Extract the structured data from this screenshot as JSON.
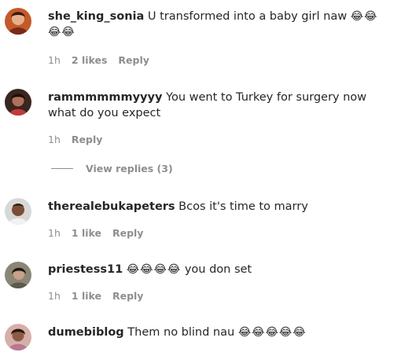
{
  "comments": [
    {
      "username": "she_king_sonia",
      "text": " U transformed into a baby girl naw ",
      "emoji": "😂😂😂😂",
      "time": "1h",
      "likes": "2 likes",
      "reply": "Reply"
    },
    {
      "username": "rammmmmmyyyy",
      "text": " You went to Turkey for surgery now what do you expect",
      "emoji": "",
      "time": "1h",
      "likes": "",
      "reply": "Reply",
      "view_replies": "View replies (3)"
    },
    {
      "username": "therealebukapeters",
      "text": " Bcos it's time to marry",
      "emoji": "",
      "time": "1h",
      "likes": "1 like",
      "reply": "Reply"
    },
    {
      "username": "priestess11",
      "text": " you don set",
      "emoji": "😂😂😂😂",
      "time": "1h",
      "likes": "1 like",
      "reply": "Reply"
    },
    {
      "username": "dumebiblog",
      "text": " Them no blind nau ",
      "emoji": "😂😂😂😂😂",
      "time": "",
      "likes": "",
      "reply": ""
    }
  ]
}
